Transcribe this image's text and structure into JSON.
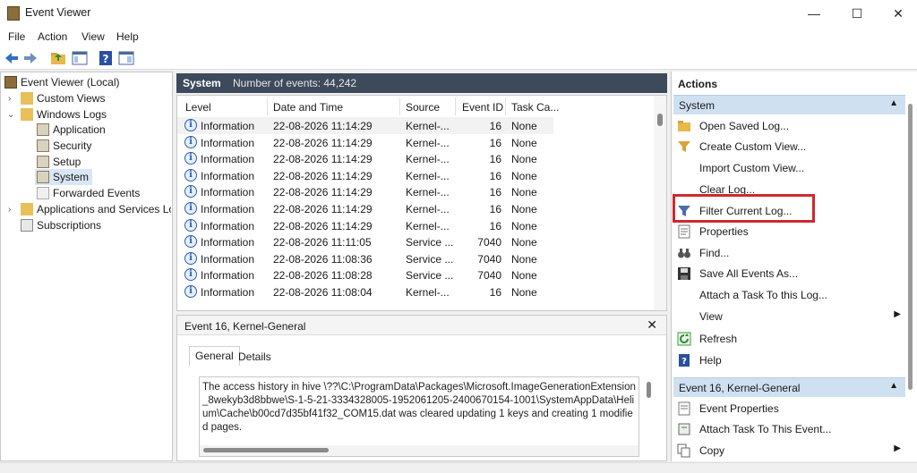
{
  "window": {
    "title": "Event Viewer",
    "minimize": "—",
    "maximize": "☐",
    "close": "✕"
  },
  "menu": [
    "File",
    "Action",
    "View",
    "Help"
  ],
  "tree": {
    "root": "Event Viewer (Local)",
    "custom_views": "Custom Views",
    "windows_logs": "Windows Logs",
    "application": "Application",
    "security": "Security",
    "setup": "Setup",
    "system": "System",
    "forwarded": "Forwarded Events",
    "apps_services": "Applications and Services Logs",
    "subscriptions": "Subscriptions"
  },
  "log_header": {
    "name": "System",
    "count": "Number of events: 44,242"
  },
  "columns": [
    "Level",
    "Date and Time",
    "Source",
    "Event ID",
    "Task Ca..."
  ],
  "events": [
    {
      "level": "Information",
      "date": "22-08-2026 11:14:29",
      "source": "Kernel-...",
      "id": "16",
      "task": "None"
    },
    {
      "level": "Information",
      "date": "22-08-2026 11:14:29",
      "source": "Kernel-...",
      "id": "16",
      "task": "None"
    },
    {
      "level": "Information",
      "date": "22-08-2026 11:14:29",
      "source": "Kernel-...",
      "id": "16",
      "task": "None"
    },
    {
      "level": "Information",
      "date": "22-08-2026 11:14:29",
      "source": "Kernel-...",
      "id": "16",
      "task": "None"
    },
    {
      "level": "Information",
      "date": "22-08-2026 11:14:29",
      "source": "Kernel-...",
      "id": "16",
      "task": "None"
    },
    {
      "level": "Information",
      "date": "22-08-2026 11:14:29",
      "source": "Kernel-...",
      "id": "16",
      "task": "None"
    },
    {
      "level": "Information",
      "date": "22-08-2026 11:14:29",
      "source": "Kernel-...",
      "id": "16",
      "task": "None"
    },
    {
      "level": "Information",
      "date": "22-08-2026 11:11:05",
      "source": "Service ...",
      "id": "7040",
      "task": "None"
    },
    {
      "level": "Information",
      "date": "22-08-2026 11:08:36",
      "source": "Service ...",
      "id": "7040",
      "task": "None"
    },
    {
      "level": "Information",
      "date": "22-08-2026 11:08:28",
      "source": "Service ...",
      "id": "7040",
      "task": "None"
    },
    {
      "level": "Information",
      "date": "22-08-2026 11:08:04",
      "source": "Kernel-...",
      "id": "16",
      "task": "None"
    }
  ],
  "detail": {
    "title": "Event 16, Kernel-General",
    "close": "✕",
    "tab_general": "General",
    "tab_details": "Details",
    "description": "The access history in hive \\??\\C:\\ProgramData\\Packages\\Microsoft.ImageGenerationExtension_8wekyb3d8bbwe\\S-1-5-21-3334328005-1952061205-2400670154-1001\\SystemAppData\\Helium\\Cache\\b00cd7d35bf41f32_COM15.dat was cleared updating 1 keys and creating 1 modified pages."
  },
  "actions": {
    "title": "Actions",
    "section_system": "System",
    "section_event": "Event 16, Kernel-General",
    "items": [
      "Open Saved Log...",
      "Create Custom View...",
      "Import Custom View...",
      "Clear Log...",
      "Filter Current Log...",
      "Properties",
      "Find...",
      "Save All Events As...",
      "Attach a Task To this Log...",
      "View",
      "Refresh",
      "Help"
    ],
    "event_items": [
      "Event Properties",
      "Attach Task To This Event...",
      "Copy"
    ]
  },
  "colors": {
    "header_bg": "#3d4a5c",
    "section_bg": "#cfe0f1",
    "highlight": "#d0282e"
  }
}
